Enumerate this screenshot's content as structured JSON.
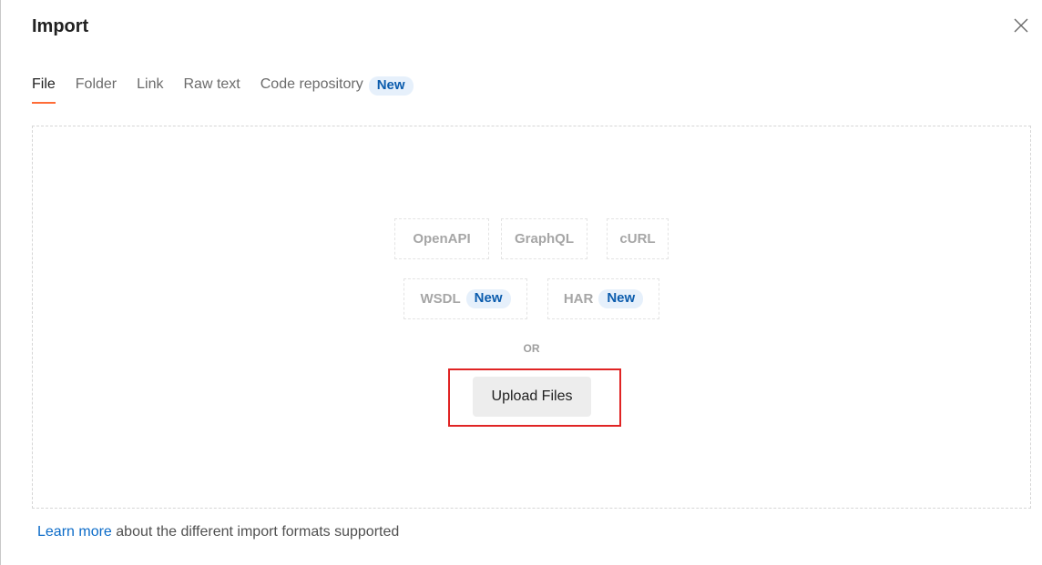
{
  "dialog": {
    "title": "Import",
    "close_icon": "close-icon"
  },
  "tabs": [
    {
      "label": "File",
      "active": true
    },
    {
      "label": "Folder",
      "active": false
    },
    {
      "label": "Link",
      "active": false
    },
    {
      "label": "Raw text",
      "active": false
    },
    {
      "label": "Code repository",
      "active": false,
      "badge": "New"
    }
  ],
  "formats": {
    "row1": [
      {
        "label": "OpenAPI"
      },
      {
        "label": "GraphQL"
      },
      {
        "label": "cURL"
      }
    ],
    "row2": [
      {
        "label": "WSDL",
        "badge": "New"
      },
      {
        "label": "HAR",
        "badge": "New"
      }
    ]
  },
  "separator": "OR",
  "upload_button": "Upload Files",
  "footer": {
    "link_text": "Learn more",
    "text": " about the different import formats supported"
  },
  "colors": {
    "accent": "#ff6c37",
    "badge_bg": "#e6f0fb",
    "badge_text": "#0b5cad",
    "highlight": "#e02424",
    "link": "#0b6bc8"
  }
}
